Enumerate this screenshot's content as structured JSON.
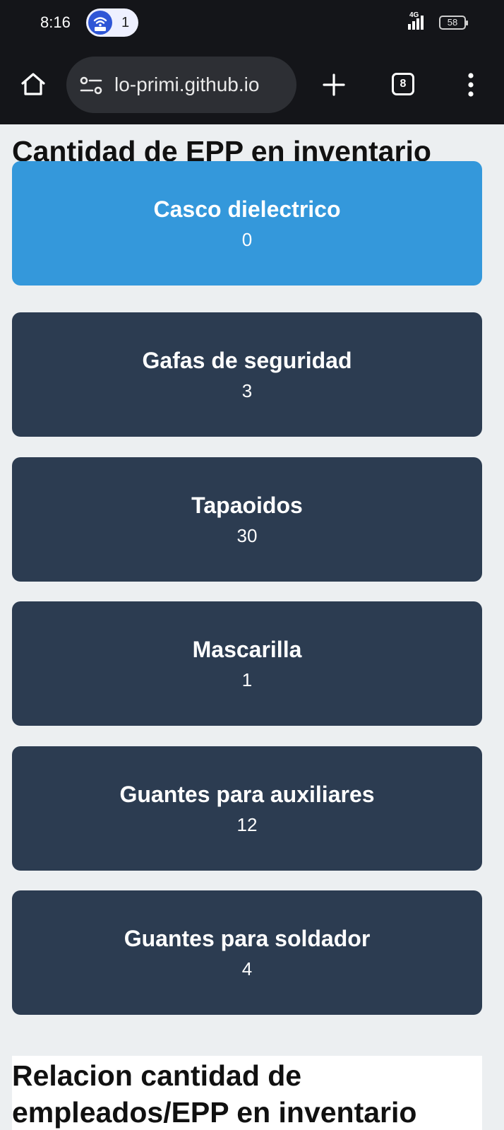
{
  "status_bar": {
    "time": "8:16",
    "notification_count": "1",
    "network": "4G",
    "battery": "58"
  },
  "browser": {
    "url": "lo-primi.github.io",
    "tab_count": "8"
  },
  "page": {
    "title": "Cantidad de EPP en inventario",
    "items": [
      {
        "name": "Casco dielectrico",
        "count": "0",
        "color": "#3498db"
      },
      {
        "name": "Gafas de seguridad",
        "count": "3",
        "color": "#2c3c51"
      },
      {
        "name": "Tapaoidos",
        "count": "30",
        "color": "#2c3c51"
      },
      {
        "name": "Mascarilla",
        "count": "1",
        "color": "#2c3c51"
      },
      {
        "name": "Guantes para auxiliares",
        "count": "12",
        "color": "#2c3c51"
      },
      {
        "name": "Guantes para soldador",
        "count": "4",
        "color": "#2c3c51"
      }
    ],
    "section2_title": "Relacion cantidad de empleados/EPP en inventario"
  }
}
